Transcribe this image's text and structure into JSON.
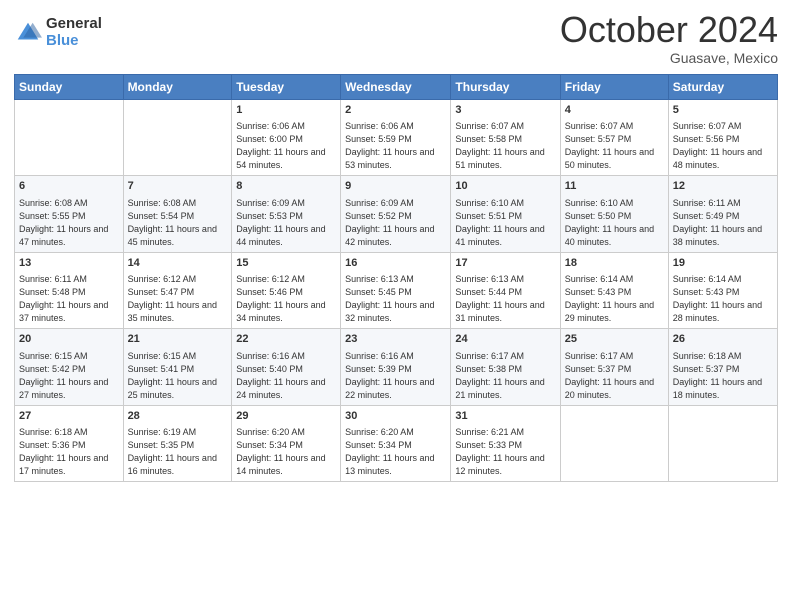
{
  "header": {
    "logo_general": "General",
    "logo_blue": "Blue",
    "month_title": "October 2024",
    "subtitle": "Guasave, Mexico"
  },
  "days_of_week": [
    "Sunday",
    "Monday",
    "Tuesday",
    "Wednesday",
    "Thursday",
    "Friday",
    "Saturday"
  ],
  "weeks": [
    [
      {
        "day": "",
        "info": ""
      },
      {
        "day": "",
        "info": ""
      },
      {
        "day": "1",
        "info": "Sunrise: 6:06 AM\nSunset: 6:00 PM\nDaylight: 11 hours and 54 minutes."
      },
      {
        "day": "2",
        "info": "Sunrise: 6:06 AM\nSunset: 5:59 PM\nDaylight: 11 hours and 53 minutes."
      },
      {
        "day": "3",
        "info": "Sunrise: 6:07 AM\nSunset: 5:58 PM\nDaylight: 11 hours and 51 minutes."
      },
      {
        "day": "4",
        "info": "Sunrise: 6:07 AM\nSunset: 5:57 PM\nDaylight: 11 hours and 50 minutes."
      },
      {
        "day": "5",
        "info": "Sunrise: 6:07 AM\nSunset: 5:56 PM\nDaylight: 11 hours and 48 minutes."
      }
    ],
    [
      {
        "day": "6",
        "info": "Sunrise: 6:08 AM\nSunset: 5:55 PM\nDaylight: 11 hours and 47 minutes."
      },
      {
        "day": "7",
        "info": "Sunrise: 6:08 AM\nSunset: 5:54 PM\nDaylight: 11 hours and 45 minutes."
      },
      {
        "day": "8",
        "info": "Sunrise: 6:09 AM\nSunset: 5:53 PM\nDaylight: 11 hours and 44 minutes."
      },
      {
        "day": "9",
        "info": "Sunrise: 6:09 AM\nSunset: 5:52 PM\nDaylight: 11 hours and 42 minutes."
      },
      {
        "day": "10",
        "info": "Sunrise: 6:10 AM\nSunset: 5:51 PM\nDaylight: 11 hours and 41 minutes."
      },
      {
        "day": "11",
        "info": "Sunrise: 6:10 AM\nSunset: 5:50 PM\nDaylight: 11 hours and 40 minutes."
      },
      {
        "day": "12",
        "info": "Sunrise: 6:11 AM\nSunset: 5:49 PM\nDaylight: 11 hours and 38 minutes."
      }
    ],
    [
      {
        "day": "13",
        "info": "Sunrise: 6:11 AM\nSunset: 5:48 PM\nDaylight: 11 hours and 37 minutes."
      },
      {
        "day": "14",
        "info": "Sunrise: 6:12 AM\nSunset: 5:47 PM\nDaylight: 11 hours and 35 minutes."
      },
      {
        "day": "15",
        "info": "Sunrise: 6:12 AM\nSunset: 5:46 PM\nDaylight: 11 hours and 34 minutes."
      },
      {
        "day": "16",
        "info": "Sunrise: 6:13 AM\nSunset: 5:45 PM\nDaylight: 11 hours and 32 minutes."
      },
      {
        "day": "17",
        "info": "Sunrise: 6:13 AM\nSunset: 5:44 PM\nDaylight: 11 hours and 31 minutes."
      },
      {
        "day": "18",
        "info": "Sunrise: 6:14 AM\nSunset: 5:43 PM\nDaylight: 11 hours and 29 minutes."
      },
      {
        "day": "19",
        "info": "Sunrise: 6:14 AM\nSunset: 5:43 PM\nDaylight: 11 hours and 28 minutes."
      }
    ],
    [
      {
        "day": "20",
        "info": "Sunrise: 6:15 AM\nSunset: 5:42 PM\nDaylight: 11 hours and 27 minutes."
      },
      {
        "day": "21",
        "info": "Sunrise: 6:15 AM\nSunset: 5:41 PM\nDaylight: 11 hours and 25 minutes."
      },
      {
        "day": "22",
        "info": "Sunrise: 6:16 AM\nSunset: 5:40 PM\nDaylight: 11 hours and 24 minutes."
      },
      {
        "day": "23",
        "info": "Sunrise: 6:16 AM\nSunset: 5:39 PM\nDaylight: 11 hours and 22 minutes."
      },
      {
        "day": "24",
        "info": "Sunrise: 6:17 AM\nSunset: 5:38 PM\nDaylight: 11 hours and 21 minutes."
      },
      {
        "day": "25",
        "info": "Sunrise: 6:17 AM\nSunset: 5:37 PM\nDaylight: 11 hours and 20 minutes."
      },
      {
        "day": "26",
        "info": "Sunrise: 6:18 AM\nSunset: 5:37 PM\nDaylight: 11 hours and 18 minutes."
      }
    ],
    [
      {
        "day": "27",
        "info": "Sunrise: 6:18 AM\nSunset: 5:36 PM\nDaylight: 11 hours and 17 minutes."
      },
      {
        "day": "28",
        "info": "Sunrise: 6:19 AM\nSunset: 5:35 PM\nDaylight: 11 hours and 16 minutes."
      },
      {
        "day": "29",
        "info": "Sunrise: 6:20 AM\nSunset: 5:34 PM\nDaylight: 11 hours and 14 minutes."
      },
      {
        "day": "30",
        "info": "Sunrise: 6:20 AM\nSunset: 5:34 PM\nDaylight: 11 hours and 13 minutes."
      },
      {
        "day": "31",
        "info": "Sunrise: 6:21 AM\nSunset: 5:33 PM\nDaylight: 11 hours and 12 minutes."
      },
      {
        "day": "",
        "info": ""
      },
      {
        "day": "",
        "info": ""
      }
    ]
  ]
}
